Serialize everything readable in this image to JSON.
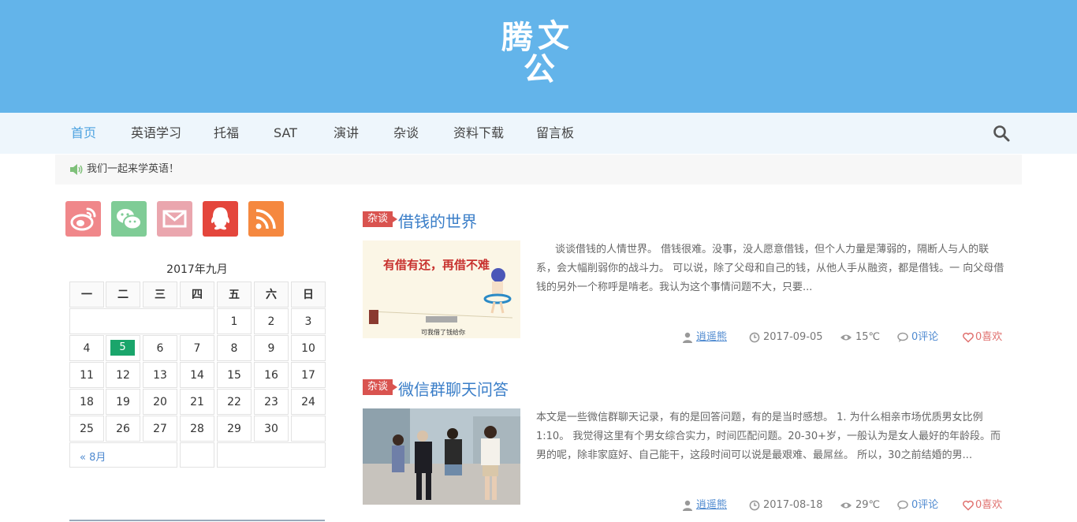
{
  "site": {
    "logo_chars": [
      "腾",
      "文",
      "公"
    ]
  },
  "nav": {
    "items": [
      {
        "label": "首页",
        "active": true
      },
      {
        "label": "英语学习"
      },
      {
        "label": "托福"
      },
      {
        "label": "SAT"
      },
      {
        "label": "演讲"
      },
      {
        "label": "杂谈"
      },
      {
        "label": "资料下载"
      },
      {
        "label": "留言板"
      }
    ],
    "search_icon": "search-icon"
  },
  "notice": {
    "text": "我们一起来学英语！",
    "icon": "speaker-icon"
  },
  "social": [
    {
      "name": "weibo",
      "color": "#f0878a"
    },
    {
      "name": "wechat",
      "color": "#7fcc96"
    },
    {
      "name": "mail",
      "color": "#eaa6ae"
    },
    {
      "name": "qq",
      "color": "#e4463c"
    },
    {
      "name": "rss",
      "color": "#f5883f"
    }
  ],
  "calendar": {
    "caption": "2017年九月",
    "weekdays": [
      "一",
      "二",
      "三",
      "四",
      "五",
      "六",
      "日"
    ],
    "weeks": [
      [
        "",
        "",
        "",
        "",
        "1",
        "2",
        "3"
      ],
      [
        "4",
        "5",
        "6",
        "7",
        "8",
        "9",
        "10"
      ],
      [
        "11",
        "12",
        "13",
        "14",
        "15",
        "16",
        "17"
      ],
      [
        "18",
        "19",
        "20",
        "21",
        "22",
        "23",
        "24"
      ],
      [
        "25",
        "26",
        "27",
        "28",
        "29",
        "30",
        ""
      ]
    ],
    "today": "5",
    "prev_link": "« 8月"
  },
  "posts": [
    {
      "category": "杂谈",
      "title": "借钱的世界",
      "thumb_caption": "有借有还，再借不难",
      "thumb_small": "可我借了钱给你",
      "excerpt": "谈谈借钱的人情世界。 借钱很难。没事，没人愿意借钱，但个人力量是薄弱的，隔断人与人的联系，会大幅削弱你的战斗力。 可以说，除了父母和自己的钱，从他人手从融资，都是借钱。一 向父母借钱的另外一个称呼是啃老。我认为这个事情问题不大，只要...",
      "author": "逍遥熊",
      "date": "2017-09-05",
      "views": "15℃",
      "comments": "0评论",
      "likes": "0喜欢"
    },
    {
      "category": "杂谈",
      "title": "微信群聊天问答",
      "excerpt": "本文是一些微信群聊天记录，有的是回答问题，有的是当时感想。 1. 为什么相亲市场优质男女比例1:10。 我觉得这里有个男女综合实力，时间匹配问题。20-30+岁，一般认为是女人最好的年龄段。而男的呢，除非家庭好、自己能干，这段时间可以说是最艰难、最屌丝。 所以，30之前结婚的男...",
      "author": "逍遥熊",
      "date": "2017-08-18",
      "views": "29℃",
      "comments": "0评论",
      "likes": "0喜欢"
    }
  ]
}
